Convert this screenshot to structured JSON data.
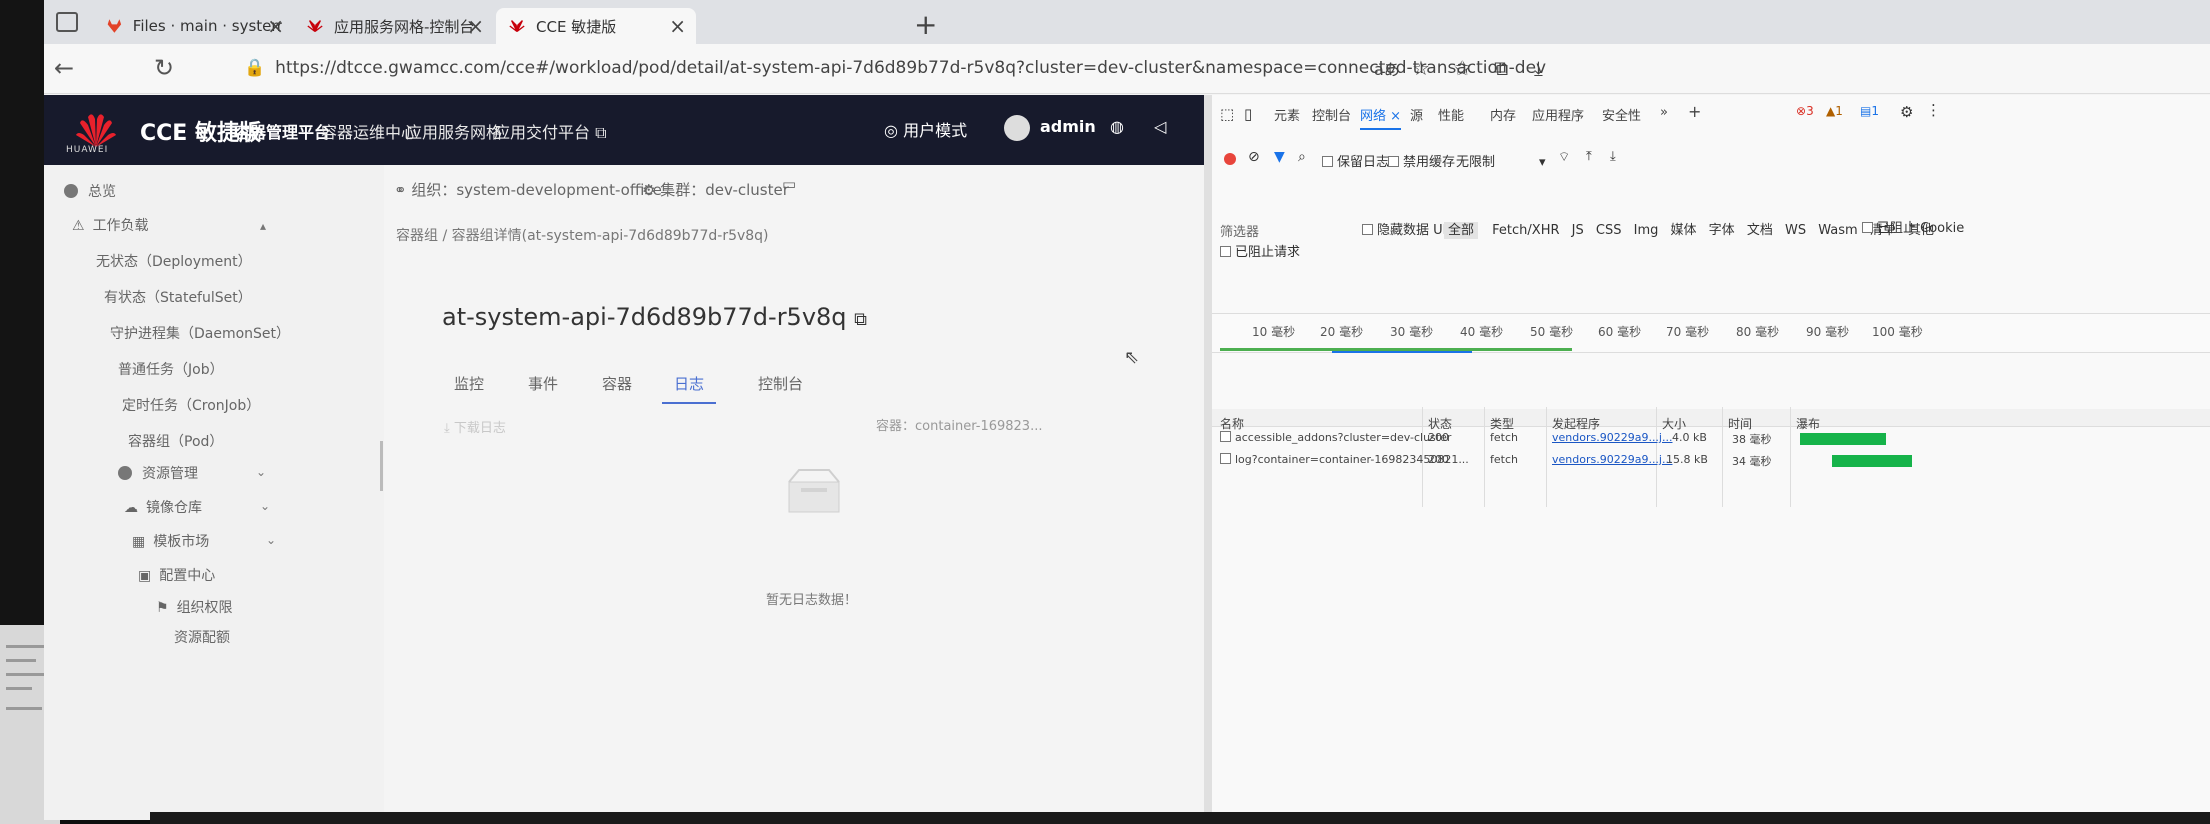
{
  "browser": {
    "tabs": [
      {
        "label": "Files · main · system-developme...",
        "active": false
      },
      {
        "label": "应用服务网格-控制台",
        "active": false
      },
      {
        "label": "CCE 敏捷版",
        "active": true
      }
    ],
    "url": "https://dtcce.gwamcc.com/cce#/workload/pod/detail/at-system-api-7d6d89b77d-r5v8q?cluster=dev-cluster&namespace=connected-transaction-dev"
  },
  "header": {
    "logo_text": "HUAWEI",
    "brand": "CCE 敏捷版",
    "nav": [
      "容器管理平台",
      "容器运维中心",
      "应用服务网格",
      "应用交付平台"
    ],
    "user_mode": "用户模式",
    "username": "admin"
  },
  "sidebar": {
    "items": [
      {
        "label": "总览"
      },
      {
        "label": "工作负载"
      },
      {
        "label": "无状态（Deployment）"
      },
      {
        "label": "有状态（StatefulSet）"
      },
      {
        "label": "守护进程集（DaemonSet）"
      },
      {
        "label": "普通任务（Job）"
      },
      {
        "label": "定时任务（CronJob）"
      },
      {
        "label": "容器组（Pod）"
      },
      {
        "label": "资源管理"
      },
      {
        "label": "镜像仓库"
      },
      {
        "label": "模板市场"
      },
      {
        "label": "配置中心"
      },
      {
        "label": "组织权限"
      },
      {
        "label": "资源配额"
      }
    ]
  },
  "content": {
    "org": "组织：system-development-office",
    "cluster": "集群：dev-cluster",
    "breadcrumb": "容器组 / 容器组详情(at-system-api-7d6d89b77d-r5v8q)",
    "pod_name": "at-system-api-7d6d89b77d-r5v8q",
    "tabs": [
      "监控",
      "事件",
      "容器",
      "日志",
      "控制台"
    ],
    "active_tab": "日志",
    "download": "下载日志",
    "container": "容器：container-169823...",
    "empty_text": "暂无日志数据！"
  },
  "devtools": {
    "tabs": [
      "元素",
      "控制台",
      "网络",
      "源",
      "性能",
      "内存",
      "应用程序",
      "安全性"
    ],
    "active_tab": "网络",
    "errors": "3",
    "warnings": "1",
    "info": "1",
    "toolbar": {
      "preserve_log": "保留日志",
      "disable_cache": "禁用缓存",
      "throttle": "无限制"
    },
    "filter": {
      "label": "筛选器",
      "hide_data_url": "隐藏数据 URL",
      "types": [
        "全部",
        "Fetch/XHR",
        "JS",
        "CSS",
        "Img",
        "媒体",
        "字体",
        "文档",
        "WS",
        "Wasm",
        "清单",
        "其他"
      ],
      "blocked_cookies": "已阻止 Cookie",
      "blocked_requests": "已阻止请求"
    },
    "timeline": [
      "10 毫秒",
      "20 毫秒",
      "30 毫秒",
      "40 毫秒",
      "50 毫秒",
      "60 毫秒",
      "70 毫秒",
      "80 毫秒",
      "90 毫秒",
      "100 毫秒"
    ],
    "columns": [
      "名称",
      "状态",
      "类型",
      "发起程序",
      "大小",
      "时间",
      "瀑布"
    ],
    "rows": [
      {
        "name": "accessible_addons?cluster=dev-cluster",
        "status": "200",
        "type": "fetch",
        "initiator": "vendors.90229a9...j...",
        "size": "4.0 kB",
        "time": "38 毫秒"
      },
      {
        "name": "log?container=container-169823450821...",
        "status": "200",
        "type": "fetch",
        "initiator": "vendors.90229a9...j...",
        "size": "15.8 kB",
        "time": "34 毫秒"
      }
    ]
  }
}
